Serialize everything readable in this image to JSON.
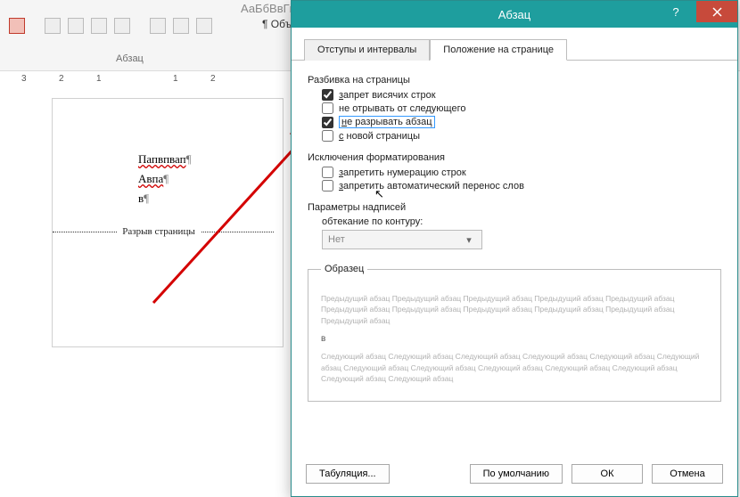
{
  "ribbon": {
    "group_label": "Абзац",
    "styles_preview": "АаБбВвГг  АаБбВвГг",
    "pilcrow_label": "¶ Объ"
  },
  "ruler": {
    "marks": [
      "3",
      "2",
      "1",
      "1",
      "2"
    ]
  },
  "doc": {
    "line1": "Папвпвап",
    "line2": "Авпа",
    "line3": "в",
    "page_break_label": "Разрыв страницы"
  },
  "dialog": {
    "title": "Абзац",
    "tabs": {
      "indents": "Отступы и интервалы",
      "position": "Положение на странице"
    },
    "groups": {
      "paging": "Разбивка на страницы",
      "exceptions": "Исключения форматирования",
      "textbox": "Параметры надписей"
    },
    "options": {
      "widow": "запрет висячих строк",
      "keep_next": "не отрывать от следующего",
      "keep_together": "не разрывать абзац",
      "page_break_before": "с новой страницы",
      "suppress_line_numbers": "запретить нумерацию строк",
      "no_hyphen": "запретить автоматический перенос слов",
      "wrap_label": "обтекание по контуру:",
      "wrap_value": "Нет"
    },
    "checked": {
      "widow": true,
      "keep_next": false,
      "keep_together": true,
      "page_break_before": false,
      "suppress_line_numbers": false,
      "no_hyphen": false
    },
    "sample": {
      "legend": "Образец",
      "prev": "Предыдущий абзац Предыдущий абзац Предыдущий абзац Предыдущий абзац Предыдущий абзац Предыдущий абзац Предыдущий абзац Предыдущий абзац Предыдущий абзац Предыдущий абзац Предыдущий абзац",
      "bullet": "в",
      "next": "Следующий абзац Следующий абзац Следующий абзац Следующий абзац Следующий абзац Следующий абзац Следующий абзац Следующий абзац Следующий абзац Следующий абзац Следующий абзац Следующий абзац Следующий абзац"
    },
    "buttons": {
      "tabs": "Табуляция...",
      "default": "По умолчанию",
      "ok": "ОК",
      "cancel": "Отмена"
    }
  }
}
